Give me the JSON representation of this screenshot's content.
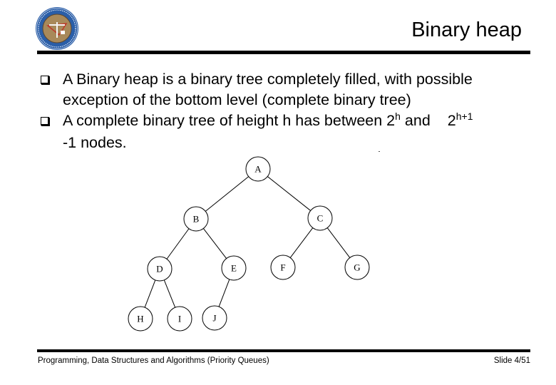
{
  "slide": {
    "title": "Binary heap",
    "logo_icon": "university-seal-logo"
  },
  "bullets": [
    {
      "lines": [
        "A Binary heap is a binary tree completely filled, with possible",
        "exception of the bottom level (complete binary tree)"
      ]
    },
    {
      "line1_prefix": "A complete binary tree of height h has between 2",
      "line1_sup1": "h",
      "line1_mid": " and",
      "line1_base2": "2",
      "line1_sup2": "h+1",
      "line2": "-1 nodes."
    }
  ],
  "tree": {
    "nodes": [
      {
        "id": "A",
        "label": "A"
      },
      {
        "id": "B",
        "label": "B"
      },
      {
        "id": "C",
        "label": "C"
      },
      {
        "id": "D",
        "label": "D"
      },
      {
        "id": "E",
        "label": "E"
      },
      {
        "id": "F",
        "label": "F"
      },
      {
        "id": "G",
        "label": "G"
      },
      {
        "id": "H",
        "label": "H"
      },
      {
        "id": "I",
        "label": "I"
      },
      {
        "id": "J",
        "label": "J"
      }
    ],
    "edges": [
      [
        "A",
        "B"
      ],
      [
        "A",
        "C"
      ],
      [
        "B",
        "D"
      ],
      [
        "B",
        "E"
      ],
      [
        "C",
        "F"
      ],
      [
        "C",
        "G"
      ],
      [
        "D",
        "H"
      ],
      [
        "D",
        "I"
      ],
      [
        "E",
        "J"
      ]
    ]
  },
  "footer": {
    "course": "Programming, Data Structures and Algorithms  (Priority Queues)",
    "slide_number": "Slide 4/51"
  },
  "colors": {
    "rule": "#000000",
    "logo_ring": "#2a5ea8",
    "logo_inner": "#a8895a"
  }
}
